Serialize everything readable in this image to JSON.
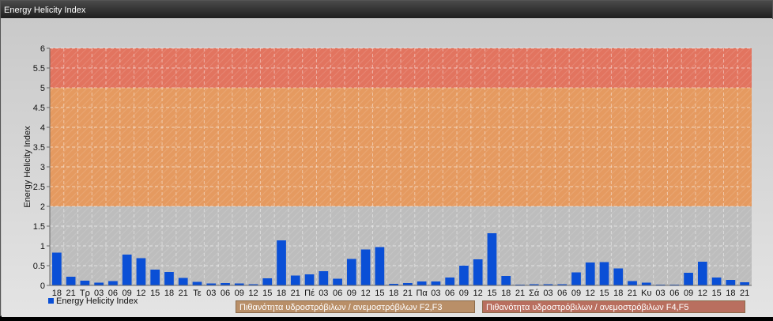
{
  "window": {
    "title": "Energy Helicity Index"
  },
  "legend": {
    "series_label": "Energy Helicity Index",
    "series_color": "#0a4fd6"
  },
  "bands": [
    {
      "label": "Πιθανότητα υδροστρόβιλων / ανεμοστρόβιλων F2,F3",
      "from": 2,
      "to": 5,
      "color": "#e59a60"
    },
    {
      "label": "Πιθανότητα υδροστρόβιλων / ανεμοστρόβιλων F4,F5",
      "from": 5,
      "to": 6,
      "color": "#e2745f"
    }
  ],
  "chart_data": {
    "type": "bar",
    "ylabel": "Energy Helicity Index",
    "ylim": [
      0,
      6
    ],
    "yticks": [
      "0",
      "0.5",
      "1",
      "1.5",
      "2",
      "2.5",
      "3",
      "3.5",
      "4",
      "4.5",
      "5",
      "5.5",
      "6"
    ],
    "grid": true,
    "legend_position": "bottom-left",
    "categories": [
      "18",
      "21",
      "Τρ",
      "03",
      "06",
      "09",
      "12",
      "15",
      "18",
      "21",
      "Τε",
      "03",
      "06",
      "09",
      "12",
      "15",
      "18",
      "21",
      "Πέ",
      "03",
      "06",
      "09",
      "12",
      "15",
      "18",
      "21",
      "Πα",
      "03",
      "06",
      "09",
      "12",
      "15",
      "18",
      "21",
      "Σά",
      "03",
      "06",
      "09",
      "12",
      "15",
      "18",
      "21",
      "Κυ",
      "03",
      "06",
      "09",
      "12",
      "15",
      "18",
      "21"
    ],
    "series": [
      {
        "name": "Energy Helicity Index",
        "values": [
          0.83,
          0.22,
          0.12,
          0.07,
          0.11,
          0.78,
          0.69,
          0.4,
          0.34,
          0.19,
          0.09,
          0.05,
          0.06,
          0.05,
          0.03,
          0.18,
          1.14,
          0.25,
          0.28,
          0.36,
          0.17,
          0.67,
          0.91,
          0.97,
          0.04,
          0.06,
          0.1,
          0.1,
          0.2,
          0.5,
          0.66,
          1.32,
          0.24,
          0.02,
          0.03,
          0.03,
          0.03,
          0.33,
          0.58,
          0.59,
          0.43,
          0.11,
          0.07,
          0.02,
          0.02,
          0.32,
          0.6,
          0.2,
          0.14,
          0.08
        ]
      }
    ]
  }
}
